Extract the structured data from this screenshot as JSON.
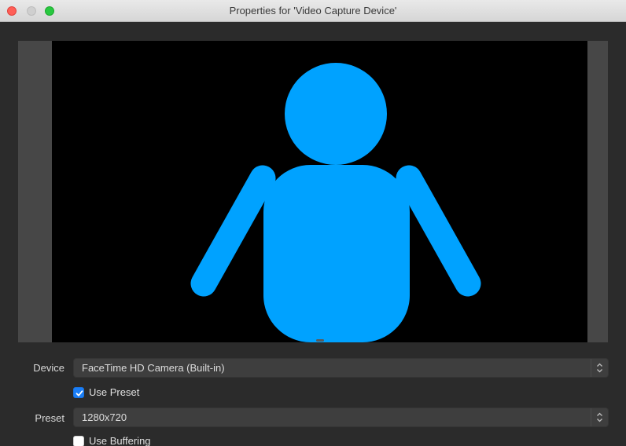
{
  "window": {
    "title": "Properties for 'Video Capture Device'"
  },
  "preview": {
    "figure_color": "#00a2ff",
    "background_color": "#000000"
  },
  "form": {
    "device": {
      "label": "Device",
      "value": "FaceTime HD Camera (Built-in)"
    },
    "use_preset": {
      "label": "Use Preset",
      "checked": true
    },
    "preset": {
      "label": "Preset",
      "value": "1280x720"
    },
    "use_buffering": {
      "label": "Use Buffering",
      "checked": false
    }
  },
  "icons": {
    "traffic_close": "close-icon",
    "traffic_minimize": "minimize-icon",
    "traffic_zoom": "zoom-icon",
    "select_arrows": "up-down-chevron-icon",
    "checkmark": "checkmark-icon"
  }
}
